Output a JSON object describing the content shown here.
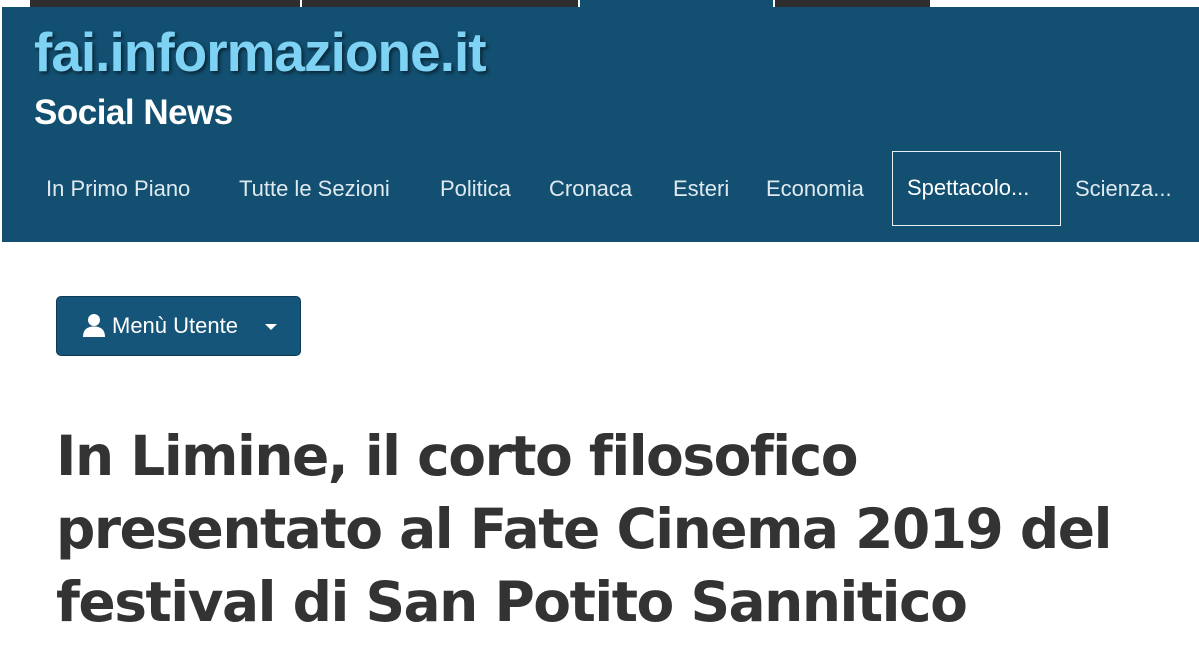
{
  "site": {
    "logo_text": "fai.informazione.it",
    "tagline": "Social News"
  },
  "nav": {
    "items": [
      {
        "label": "In Primo Piano"
      },
      {
        "label": "Tutte le Sezioni"
      },
      {
        "label": "Politica"
      },
      {
        "label": "Cronaca"
      },
      {
        "label": "Esteri"
      },
      {
        "label": "Economia"
      },
      {
        "label": "Spettacolo...",
        "active": true
      },
      {
        "label": "Scienza..."
      }
    ]
  },
  "user_menu": {
    "label": "Menù Utente",
    "icon": "user-icon"
  },
  "article": {
    "title": "In Limine, il corto filosofico presentato al Fate Cinema 2019 del festival di San Potito Sannitico"
  },
  "colors": {
    "header_bg": "#124f70",
    "logo": "#7ed3f5",
    "button_bg": "#15557a",
    "title_text": "#333333"
  }
}
